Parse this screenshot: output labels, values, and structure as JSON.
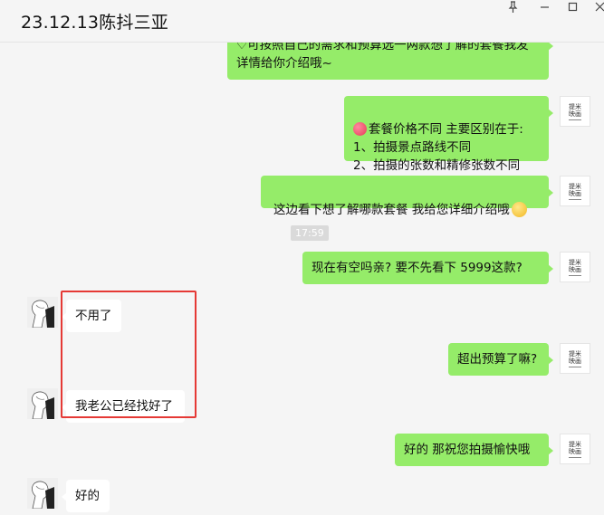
{
  "window": {
    "title": "23.12.13陈抖三亚",
    "controls": {
      "pin": "pin-icon",
      "minimize": "minimize-icon",
      "maximize": "maximize-icon",
      "close": "close-icon"
    }
  },
  "avatars": {
    "self_line1": "提米",
    "self_line2": "映画"
  },
  "messages": [
    {
      "side": "out",
      "text": "♡可按照自己的需求和预算选一两款想了解的套餐我发\n详情给你介绍哦~"
    },
    {
      "side": "out",
      "text": "套餐价格不同 主要区别在于:\n1、拍摄景点路线不同\n2、拍摄的张数和精修张数不同"
    },
    {
      "side": "out",
      "text": "这边看下想了解哪款套餐  我给您详细介绍哦"
    },
    {
      "timestamp": "17:59"
    },
    {
      "side": "out",
      "text": "现在有空吗亲?   要不先看下 5999这款?"
    },
    {
      "side": "in",
      "text": "不用了"
    },
    {
      "side": "out",
      "text": "超出预算了嘛?"
    },
    {
      "side": "in",
      "text": "我老公已经找好了"
    },
    {
      "side": "out",
      "text": "好的  那祝您拍摄愉快哦"
    },
    {
      "side": "in",
      "text": "好的"
    }
  ],
  "colors": {
    "outgoing_bubble": "#95ec69",
    "incoming_bubble": "#ffffff",
    "highlight": "#e53935",
    "background": "#f5f5f5"
  }
}
